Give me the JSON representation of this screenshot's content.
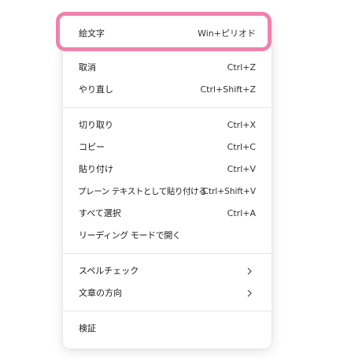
{
  "menu": {
    "items": [
      {
        "label": "絵文字",
        "shortcut": "Win+ピリオド"
      },
      {
        "label": "取消",
        "shortcut": "Ctrl+Z"
      },
      {
        "label": "やり直し",
        "shortcut": "Ctrl+Shift+Z"
      },
      {
        "label": "切り取り",
        "shortcut": "Ctrl+X"
      },
      {
        "label": "コピー",
        "shortcut": "Ctrl+C"
      },
      {
        "label": "貼り付け",
        "shortcut": "Ctrl+V"
      },
      {
        "label": "プレーン テキストとして貼り付ける",
        "shortcut": "Ctrl+Shift+V"
      },
      {
        "label": "すべて選択",
        "shortcut": "Ctrl+A"
      },
      {
        "label": "リーディング モードで開く",
        "shortcut": ""
      },
      {
        "label": "スペルチェック",
        "submenu_icon": "chevron-right-icon"
      },
      {
        "label": "文章の方向",
        "submenu_icon": "chevron-right-icon"
      },
      {
        "label": "検証",
        "shortcut": ""
      }
    ]
  },
  "colors": {
    "highlight_border": "#ef82ad",
    "menu_background": "#ffffff",
    "text": "#1a1a1a"
  }
}
